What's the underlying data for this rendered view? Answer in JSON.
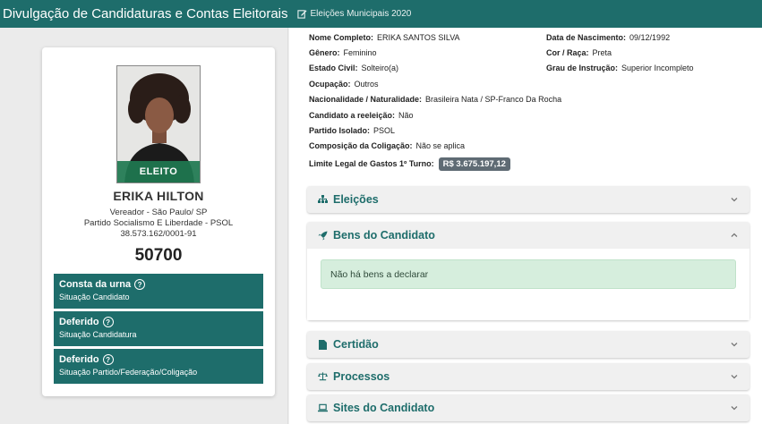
{
  "header": {
    "title": "Divulgação de Candidaturas e Contas Eleitorais",
    "election": "Eleições Municipais 2020"
  },
  "candidate": {
    "photo_badge": "ELEITO",
    "name": "ERIKA HILTON",
    "office": "Vereador - São Paulo/ SP",
    "party": "Partido Socialismo E Liberdade - PSOL",
    "cnpj": "38.573.162/0001-91",
    "number": "50700"
  },
  "statuses": [
    {
      "title": "Consta da urna",
      "subtitle": "Situação Candidato"
    },
    {
      "title": "Deferido",
      "subtitle": "Situação Candidatura"
    },
    {
      "title": "Deferido",
      "subtitle": "Situação Partido/Federação/Coligação"
    }
  ],
  "details": {
    "nome_completo": {
      "label": "Nome Completo:",
      "value": "ERIKA SANTOS SILVA"
    },
    "data_nascimento": {
      "label": "Data de Nascimento:",
      "value": "09/12/1992"
    },
    "genero": {
      "label": "Gênero:",
      "value": "Feminino"
    },
    "cor_raca": {
      "label": "Cor / Raça:",
      "value": "Preta"
    },
    "estado_civil": {
      "label": "Estado Civil:",
      "value": "Solteiro(a)"
    },
    "grau_instrucao": {
      "label": "Grau de Instrução:",
      "value": "Superior Incompleto"
    },
    "ocupacao": {
      "label": "Ocupação:",
      "value": "Outros"
    },
    "nacionalidade": {
      "label": "Nacionalidade / Naturalidade:",
      "value": "Brasileira Nata / SP-Franco Da Rocha"
    },
    "reeleicao": {
      "label": "Candidato a reeleição:",
      "value": "Não"
    },
    "partido_isolado": {
      "label": "Partido Isolado:",
      "value": "PSOL"
    },
    "composicao": {
      "label": "Composição da Coligação:",
      "value": "Não se aplica"
    },
    "limite_gastos": {
      "label": "Limite Legal de Gastos 1º Turno:",
      "value": "R$ 3.675.197,12"
    }
  },
  "sections": {
    "eleicoes": "Eleições",
    "bens": "Bens do Candidato",
    "bens_empty": "Não há bens a declarar",
    "certidao": "Certidão",
    "processos": "Processos",
    "sites": "Sites do Candidato"
  },
  "colors": {
    "brand": "#1e6d6b",
    "alert_bg": "#d6eedd",
    "badge_bg": "#5f6b74"
  }
}
